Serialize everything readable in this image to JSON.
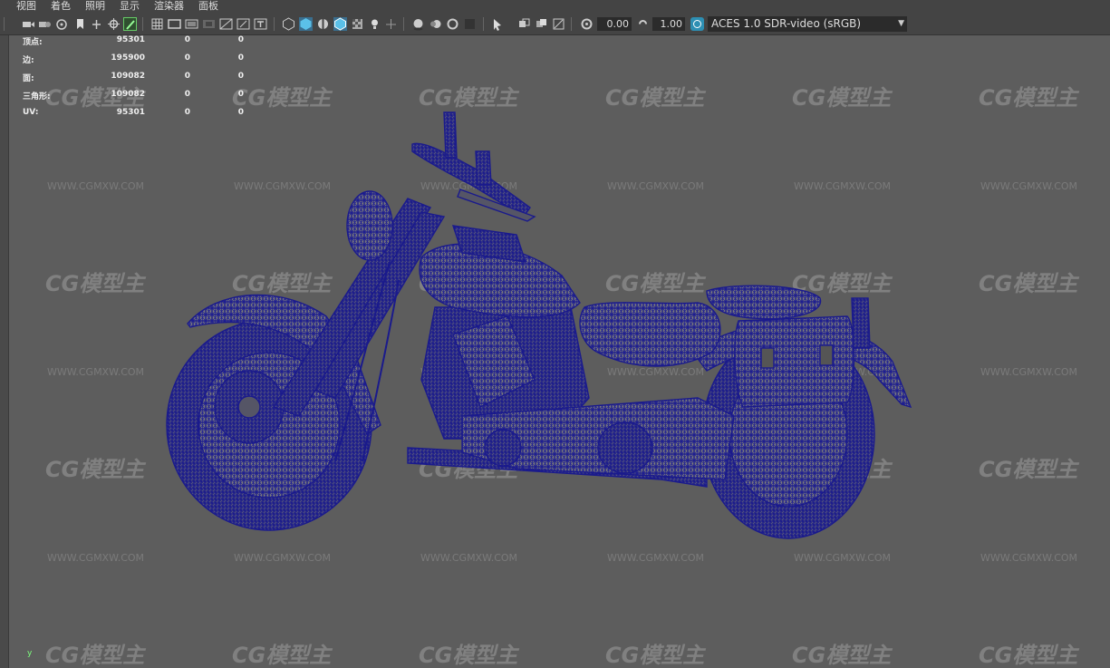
{
  "menu": [
    "视图",
    "着色",
    "照明",
    "显示",
    "渲染器",
    "面板"
  ],
  "toolbar": {
    "exposure": "0.00",
    "gamma": "1.00",
    "color_space": "ACES 1.0 SDR-video (sRGB)"
  },
  "hud": {
    "rows": [
      {
        "label": "顶点:",
        "v1": "95301",
        "v2": "0",
        "v3": "0"
      },
      {
        "label": "边:",
        "v1": "195900",
        "v2": "0",
        "v3": "0"
      },
      {
        "label": "面:",
        "v1": "109082",
        "v2": "0",
        "v3": "0"
      },
      {
        "label": "三角形:",
        "v1": "109082",
        "v2": "0",
        "v3": "0"
      },
      {
        "label": "UV:",
        "v1": "95301",
        "v2": "0",
        "v3": "0"
      }
    ]
  },
  "watermark": {
    "logo": "CG模型主",
    "url": "WWW.CGMXW.COM"
  },
  "axis_label": "y",
  "colors": {
    "viewport_bg": "#5d5d5d",
    "wireframe": "#1a1a8c",
    "toolbar_bg": "#444444"
  }
}
